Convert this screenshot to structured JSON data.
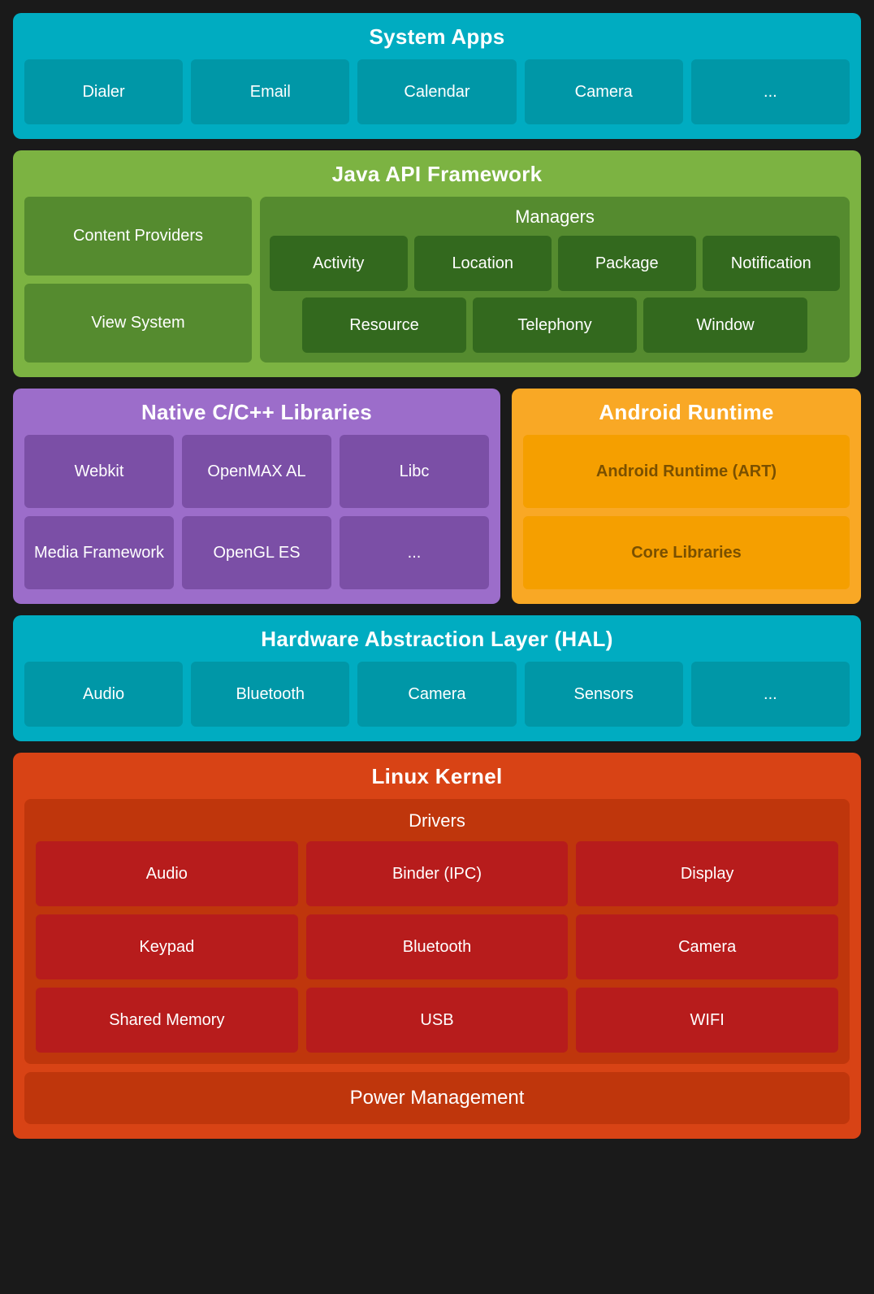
{
  "systemApps": {
    "title": "System Apps",
    "items": [
      "Dialer",
      "Email",
      "Calendar",
      "Camera",
      "..."
    ]
  },
  "javaAPI": {
    "title": "Java API Framework",
    "leftItems": [
      "Content Providers",
      "View System"
    ],
    "managers": {
      "title": "Managers",
      "row1": [
        "Activity",
        "Location",
        "Package",
        "Notification"
      ],
      "row2": [
        "Resource",
        "Telephony",
        "Window"
      ]
    }
  },
  "nativeLibs": {
    "title": "Native C/C++ Libraries",
    "items": [
      "Webkit",
      "OpenMAX AL",
      "Libc",
      "Media Framework",
      "OpenGL ES",
      "..."
    ]
  },
  "androidRuntime": {
    "title": "Android Runtime",
    "items": [
      "Android Runtime (ART)",
      "Core Libraries"
    ]
  },
  "hal": {
    "title": "Hardware Abstraction Layer (HAL)",
    "items": [
      "Audio",
      "Bluetooth",
      "Camera",
      "Sensors",
      "..."
    ]
  },
  "linuxKernel": {
    "title": "Linux Kernel",
    "driversTitle": "Drivers",
    "drivers": [
      "Audio",
      "Binder (IPC)",
      "Display",
      "Keypad",
      "Bluetooth",
      "Camera",
      "Shared Memory",
      "USB",
      "WIFI"
    ],
    "powerManagement": "Power Management"
  }
}
